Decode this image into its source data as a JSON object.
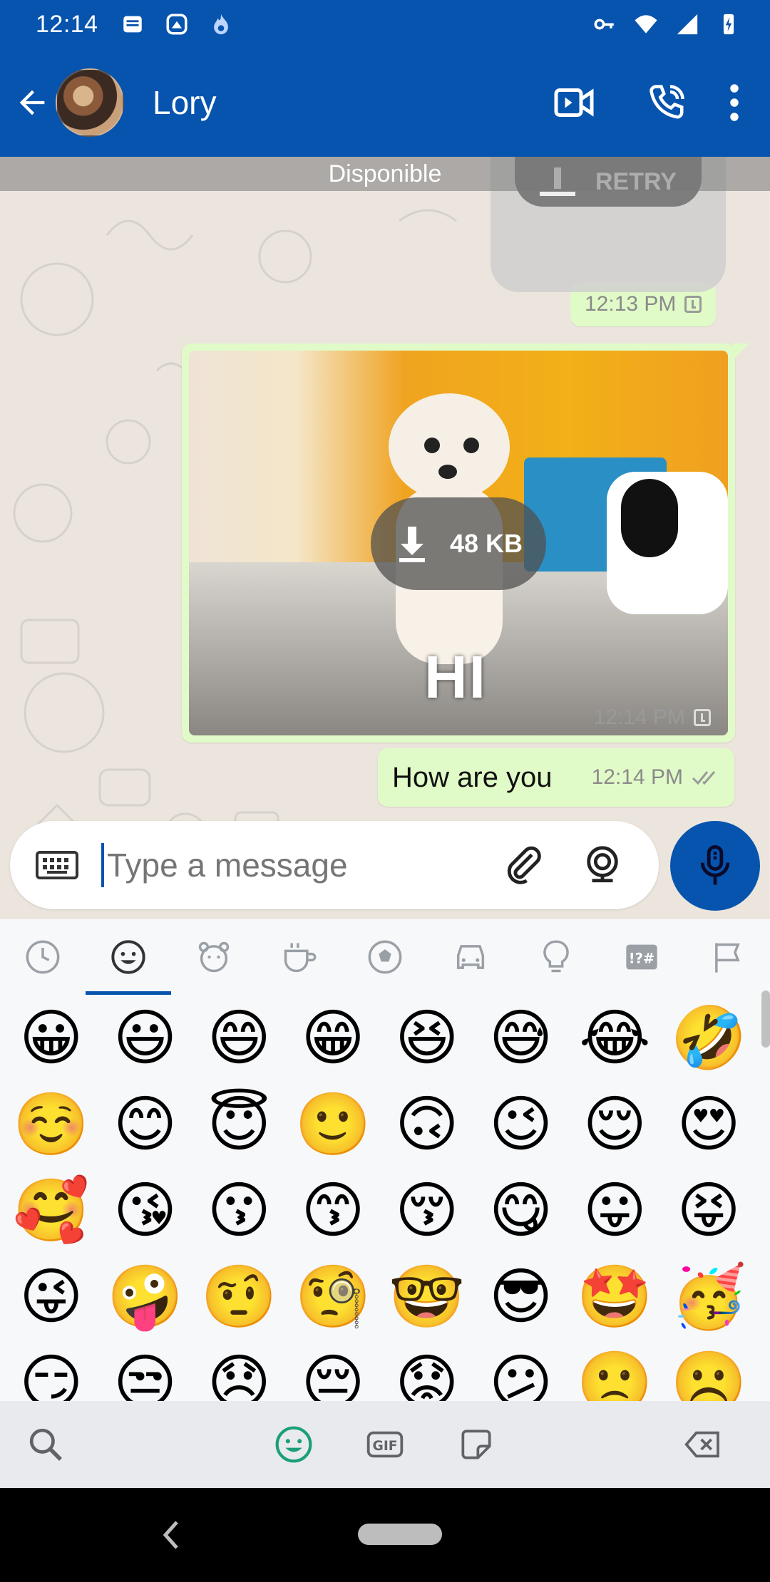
{
  "status_bar": {
    "time": "12:14"
  },
  "app_bar": {
    "contact_name": "Lory"
  },
  "chat": {
    "contact_status": "Disponible",
    "retry_label": "RETRY",
    "prev_time": "12:13 PM",
    "media": {
      "size_label": "48 KB",
      "caption_on_image": "HI",
      "time": "12:14 PM"
    },
    "text_message": {
      "text": "How are you",
      "time": "12:14 PM"
    }
  },
  "composer": {
    "placeholder": "Type a message"
  },
  "emoji_tabs": [
    "recent",
    "smileys",
    "animals",
    "food",
    "activities",
    "travel",
    "objects",
    "symbols",
    "flags"
  ],
  "emoji_rows": [
    [
      "😀",
      "😃",
      "😄",
      "😁",
      "😆",
      "😅",
      "😂",
      "🤣"
    ],
    [
      "☺️",
      "😊",
      "😇",
      "🙂",
      "🙃",
      "😉",
      "😌",
      "😍"
    ],
    [
      "🥰",
      "😘",
      "😗",
      "😙",
      "😚",
      "😋",
      "😛",
      "😝"
    ],
    [
      "😜",
      "🤪",
      "🤨",
      "🧐",
      "🤓",
      "😎",
      "🤩",
      "🥳"
    ],
    [
      "😏",
      "😒",
      "😞",
      "😔",
      "😟",
      "😕",
      "🙁",
      "☹️"
    ]
  ],
  "colors": {
    "brand": "#0754AE",
    "bubble": "#E1FBC8",
    "chat_bg": "#ECE5DD"
  }
}
